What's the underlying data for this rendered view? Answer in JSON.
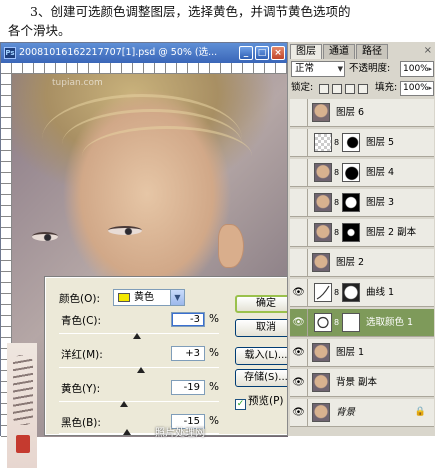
{
  "caption": {
    "line1": "3、创建可选颜色调整图层，选择黄色，并调节黄色选项的",
    "line2": "各个滑块。"
  },
  "document_window": {
    "title": "20081016162217707[1].psd @ 50% (选...",
    "watermark": "tupian.com",
    "buttons": {
      "minimize": "_",
      "maximize": "□",
      "close": "×"
    }
  },
  "selective_color": {
    "colors_label": "颜色(O):",
    "colors_value": "黄色",
    "sliders": [
      {
        "label": "青色(C):",
        "value": "-3",
        "unit": "%",
        "level": -3
      },
      {
        "label": "洋红(M):",
        "value": "+3",
        "unit": "%",
        "level": 3
      },
      {
        "label": "黄色(Y):",
        "value": "-19",
        "unit": "%",
        "level": -19
      },
      {
        "label": "黑色(B):",
        "value": "-15",
        "unit": "%",
        "level": -15
      }
    ],
    "buttons": {
      "ok": "确定",
      "cancel": "取消",
      "load": "载入(L)...",
      "save": "存储(S)..."
    },
    "preview": {
      "label": "预览(P)",
      "checked": "✓"
    },
    "swatch_color": "#f4e800"
  },
  "photo_credit": "照片处理网",
  "layers_panel": {
    "tabs": [
      "图层",
      "通道",
      "路径"
    ],
    "close": "×",
    "blend_mode": "正常",
    "opacity_label": "不透明度:",
    "opacity_value": "100%",
    "lock_label": "锁定:",
    "fill_label": "填充:",
    "fill_value": "100%",
    "eye_glyph": "👁",
    "chain_glyph": "8",
    "lock_glyph": "🔒",
    "layers": [
      {
        "name": "图层 6",
        "visible": false,
        "mask": false
      },
      {
        "name": "图层 5",
        "visible": false,
        "mask": true
      },
      {
        "name": "图层 4",
        "visible": false,
        "mask": true
      },
      {
        "name": "图层 3",
        "visible": false,
        "mask": true
      },
      {
        "name": "图层 2 副本",
        "visible": false,
        "mask": true
      },
      {
        "name": "图层 2",
        "visible": false,
        "mask": false
      },
      {
        "name": "曲线 1",
        "visible": true,
        "mask": true
      },
      {
        "name": "选取颜色 1",
        "visible": true,
        "mask": true,
        "selected": true
      },
      {
        "name": "图层 1",
        "visible": true,
        "mask": false
      },
      {
        "name": "背景 副本",
        "visible": true,
        "mask": false
      },
      {
        "name": "背景",
        "visible": true,
        "mask": false,
        "locked": true
      }
    ]
  }
}
